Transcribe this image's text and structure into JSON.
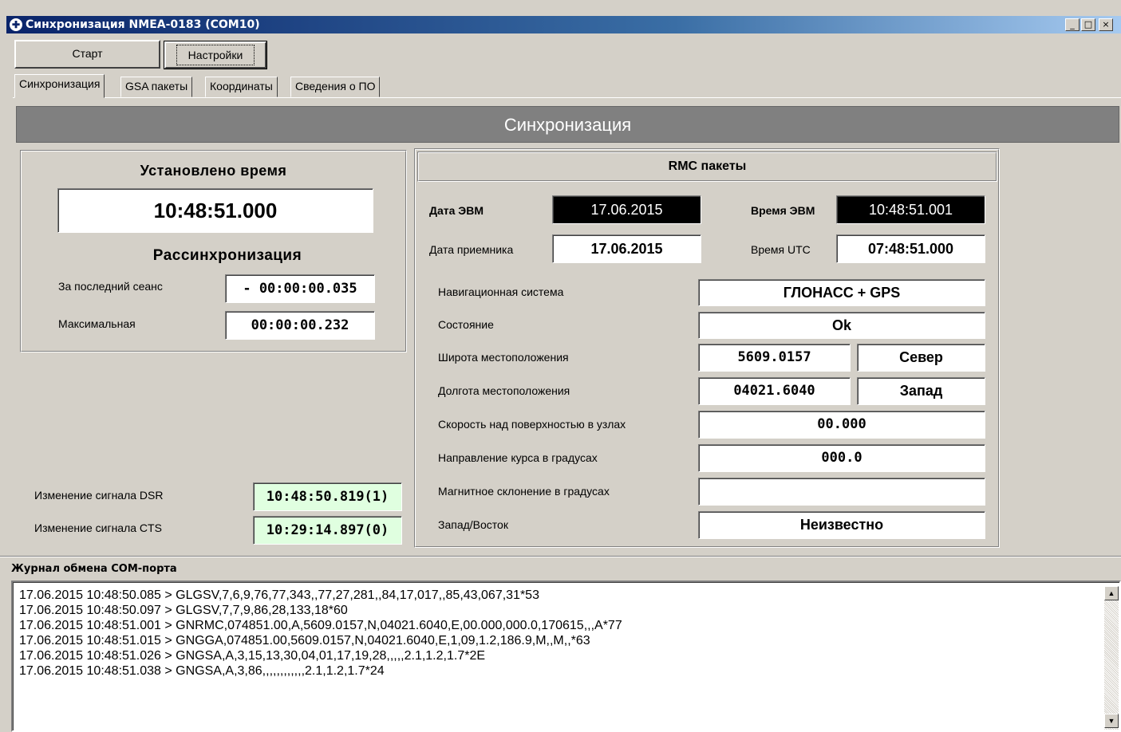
{
  "window": {
    "title": "Синхронизация NMEA-0183 (COM10)",
    "minimize": "_",
    "maximize": "□",
    "close": "×"
  },
  "toolbar": {
    "start_label": "Старт",
    "settings_label": "Настройки"
  },
  "tabs": [
    {
      "label": "Синхронизация",
      "active": true
    },
    {
      "label": "GSA пакеты",
      "active": false
    },
    {
      "label": "Координаты",
      "active": false
    },
    {
      "label": "Сведения о ПО",
      "active": false
    }
  ],
  "header": {
    "title": "Синхронизация"
  },
  "left_panel": {
    "set_time_label": "Установлено время",
    "set_time_value": "10:48:51.000",
    "desync_label": "Рассинхронизация",
    "last_session_label": "За последний сеанс",
    "last_session_value": "- 00:00:00.035",
    "max_label": "Максимальная",
    "max_value": "00:00:00.232",
    "dsr_label": "Изменение сигнала DSR",
    "dsr_value": "10:48:50.819(1)",
    "cts_label": "Изменение сигнала CTS",
    "cts_value": "10:29:14.897(0)"
  },
  "rmc": {
    "title": "RMC пакеты",
    "pc_date_label": "Дата ЭВМ",
    "pc_date_value": "17.06.2015",
    "pc_time_label": "Время ЭВМ",
    "pc_time_value": "10:48:51.001",
    "rx_date_label": "Дата приемника",
    "rx_date_value": "17.06.2015",
    "utc_label": "Время UTC",
    "utc_value": "07:48:51.000",
    "nav_label": "Навигационная система",
    "nav_value": "ГЛОНАСС + GPS",
    "state_label": "Состояние",
    "state_value": "Ok",
    "lat_label": "Широта местоположения",
    "lat_value": "5609.0157",
    "lat_dir": "Север",
    "lon_label": "Долгота местоположения",
    "lon_value": "04021.6040",
    "lon_dir": "Запад",
    "speed_label": "Скорость над поверхностью в узлах",
    "speed_value": "00.000",
    "course_label": "Направление курса в градусах",
    "course_value": "000.0",
    "magvar_label": "Магнитное склонение в градусах",
    "magvar_value": "",
    "ew_label": "Запад/Восток",
    "ew_value": "Неизвестно"
  },
  "log": {
    "title": "Журнал обмена COM-порта",
    "lines": [
      "17.06.2015 10:48:50.085 > GLGSV,7,6,9,76,77,343,,77,27,281,,84,17,017,,85,43,067,31*53",
      "17.06.2015 10:48:50.097 > GLGSV,7,7,9,86,28,133,18*60",
      "17.06.2015 10:48:51.001 > GNRMC,074851.00,A,5609.0157,N,04021.6040,E,00.000,000.0,170615,,,A*77",
      "17.06.2015 10:48:51.015 > GNGGA,074851.00,5609.0157,N,04021.6040,E,1,09,1.2,186.9,M,,M,,*63",
      "17.06.2015 10:48:51.026 > GNGSA,A,3,15,13,30,04,01,17,19,28,,,,,2.1,1.2,1.7*2E",
      "17.06.2015 10:48:51.038 > GNGSA,A,3,86,,,,,,,,,,,,2.1,1.2,1.7*24"
    ],
    "scroll_up": "▲",
    "scroll_down": "▼"
  }
}
